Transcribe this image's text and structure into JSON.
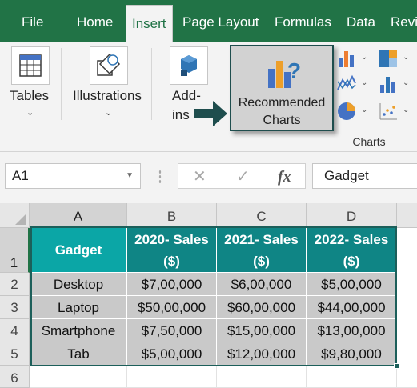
{
  "ribbon_tabs": {
    "file": "File",
    "home": "Home",
    "insert": "Insert",
    "page_layout": "Page Layout",
    "formulas": "Formulas",
    "data": "Data",
    "review": "Revi"
  },
  "ribbon": {
    "tables_label": "Tables",
    "illustrations_label": "Illustrations",
    "addins_label_1": "Add-",
    "addins_label_2": "ins",
    "chevron": "⌄",
    "recommended_charts_line1": "Recommended",
    "recommended_charts_line2": "Charts",
    "charts_group_label": "Charts"
  },
  "formula_bar": {
    "name_box": "A1",
    "cancel_glyph": "✕",
    "enter_glyph": "✓",
    "fx_glyph": "fx",
    "formula_value": "Gadget"
  },
  "columns": [
    "A",
    "B",
    "C",
    "D"
  ],
  "rows": [
    "1",
    "2",
    "3",
    "4",
    "5",
    "6"
  ],
  "table": {
    "headers": [
      "Gadget",
      "2020- Sales",
      "2021- Sales",
      "2022- Sales"
    ],
    "header_units": [
      "",
      "($)",
      "($)",
      "($)"
    ],
    "data": [
      [
        "Desktop",
        "$7,00,000",
        "$6,00,000",
        "$5,00,000"
      ],
      [
        "Laptop",
        "$50,00,000",
        "$60,00,000",
        "$44,00,000"
      ],
      [
        "Smartphone",
        "$7,50,000",
        "$15,00,000",
        "$13,00,000"
      ],
      [
        "Tab",
        "$5,00,000",
        "$12,00,000",
        "$9,80,000"
      ]
    ]
  },
  "colors": {
    "ribbon_green": "#217346",
    "table_header_teal": "#0f8585",
    "gadget_header_teal": "#0ba6a6",
    "body_gray": "#c9c9c9",
    "table_border": "#1c5f5a"
  },
  "icons": [
    "table-icon",
    "shapes-icon",
    "addins-icon",
    "recommended-charts-icon",
    "column-chart-icon",
    "hierarchy-chart-icon",
    "line-chart-icon",
    "statistic-chart-icon",
    "pie-chart-icon",
    "scatter-chart-icon",
    "arrow-pointer-icon"
  ]
}
